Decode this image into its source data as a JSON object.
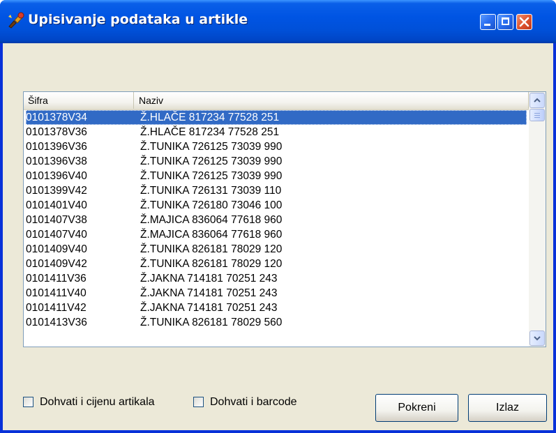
{
  "window": {
    "title": "Upisivanje podataka u artikle",
    "icon": "app-icon"
  },
  "titlebar_buttons": {
    "minimize": "minimize-icon",
    "maximize": "maximize-icon",
    "close": "close-icon"
  },
  "list": {
    "columns": [
      "Šifra",
      "Naziv"
    ],
    "selected_index": 0,
    "rows": [
      {
        "sifra": "0101378V34",
        "naziv": "Ž.HLAČE 817234 77528 251"
      },
      {
        "sifra": "0101378V36",
        "naziv": "Ž.HLAČE 817234 77528 251"
      },
      {
        "sifra": "0101396V36",
        "naziv": "Ž.TUNIKA 726125 73039 990"
      },
      {
        "sifra": "0101396V38",
        "naziv": "Ž.TUNIKA 726125 73039 990"
      },
      {
        "sifra": "0101396V40",
        "naziv": "Ž.TUNIKA 726125 73039 990"
      },
      {
        "sifra": "0101399V42",
        "naziv": "Ž.TUNIKA 726131 73039 110"
      },
      {
        "sifra": "0101401V40",
        "naziv": "Ž.TUNIKA 726180 73046 100"
      },
      {
        "sifra": "0101407V38",
        "naziv": "Ž.MAJICA 836064 77618 960"
      },
      {
        "sifra": "0101407V40",
        "naziv": "Ž.MAJICA 836064 77618 960"
      },
      {
        "sifra": "0101409V40",
        "naziv": "Ž.TUNIKA 826181 78029 120"
      },
      {
        "sifra": "0101409V42",
        "naziv": "Ž.TUNIKA 826181 78029 120"
      },
      {
        "sifra": "0101411V36",
        "naziv": "Ž.JAKNA 714181 70251 243"
      },
      {
        "sifra": "0101411V40",
        "naziv": "Ž.JAKNA 714181 70251 243"
      },
      {
        "sifra": "0101411V42",
        "naziv": "Ž.JAKNA 714181 70251 243"
      },
      {
        "sifra": "0101413V36",
        "naziv": "Ž.TUNIKA 826181 78029 560"
      }
    ]
  },
  "options": {
    "fetch_price_label": "Dohvati i cijenu artikala",
    "fetch_price_checked": false,
    "fetch_barcode_label": "Dohvati i barcode",
    "fetch_barcode_checked": false
  },
  "buttons": {
    "run_label": "Pokreni",
    "exit_label": "Izlaz"
  },
  "colors": {
    "titlebar": "#0054e3",
    "selection": "#316ac5",
    "dialog_bg": "#ece9d8"
  }
}
